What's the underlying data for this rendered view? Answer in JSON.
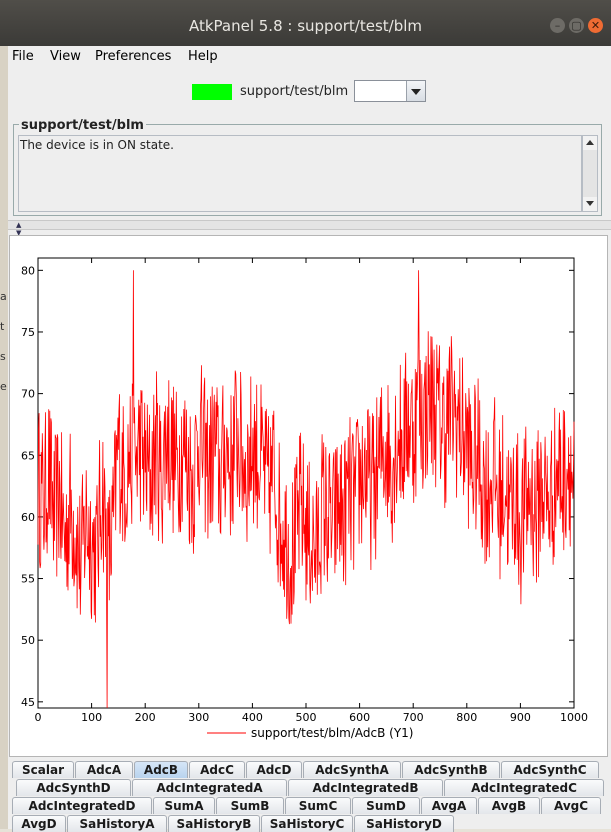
{
  "window": {
    "title": "AtkPanel 5.8 : support/test/blm"
  },
  "menu": [
    "File",
    "View",
    "Preferences",
    "Help"
  ],
  "device": {
    "name": "support/test/blm",
    "state_color": "#00ff00",
    "combo_value": ""
  },
  "status": {
    "group_title": "support/test/blm",
    "text": "The device is in ON state."
  },
  "tabs": [
    "Scalar",
    "AdcA",
    "AdcB",
    "AdcC",
    "AdcD",
    "AdcSynthA",
    "AdcSynthB",
    "AdcSynthC",
    "AdcSynthD",
    "AdcIntegratedA",
    "AdcIntegratedB",
    "AdcIntegratedC",
    "AdcIntegratedD",
    "SumA",
    "SumB",
    "SumC",
    "SumD",
    "AvgA",
    "AvgB",
    "AvgC",
    "AvgD",
    "SaHistoryA",
    "SaHistoryB",
    "SaHistoryC",
    "SaHistoryD"
  ],
  "selected_tab": "AdcB",
  "chart_data": {
    "type": "line",
    "title": "",
    "xlabel": "",
    "ylabel": "",
    "xlim": [
      0,
      1000
    ],
    "ylim": [
      44.5,
      81
    ],
    "x_ticks": [
      0,
      100,
      200,
      300,
      400,
      500,
      600,
      700,
      800,
      900,
      1000
    ],
    "y_ticks": [
      45,
      50,
      55,
      60,
      65,
      70,
      75,
      80
    ],
    "legend_position": "bottom-center",
    "grid": false,
    "series": [
      {
        "name": "support/test/blm/AdcB (Y1)",
        "color": "#ff0000",
        "x_step": 10,
        "values": [
          63,
          61,
          64,
          60,
          62,
          58,
          61,
          59,
          56,
          60,
          58,
          57,
          63,
          56,
          59,
          66,
          63,
          65,
          64,
          66,
          64,
          63,
          66,
          63,
          67,
          65,
          64,
          66,
          64,
          63,
          67,
          65,
          64,
          66,
          63,
          66,
          64,
          67,
          65,
          64,
          66,
          65,
          64,
          62,
          64,
          60,
          59,
          57,
          58,
          61,
          59,
          58,
          57,
          61,
          60,
          59,
          61,
          60,
          62,
          61,
          63,
          64,
          62,
          63,
          65,
          66,
          64,
          67,
          66,
          68,
          67,
          69,
          68,
          70,
          69,
          68,
          67,
          69,
          68,
          67,
          66,
          64,
          65,
          63,
          62,
          64,
          61,
          63,
          60,
          62,
          59,
          61,
          62,
          60,
          63,
          61,
          62,
          64,
          63,
          65,
          62
        ]
      }
    ],
    "extremes": {
      "max": 80,
      "min": 44
    }
  }
}
